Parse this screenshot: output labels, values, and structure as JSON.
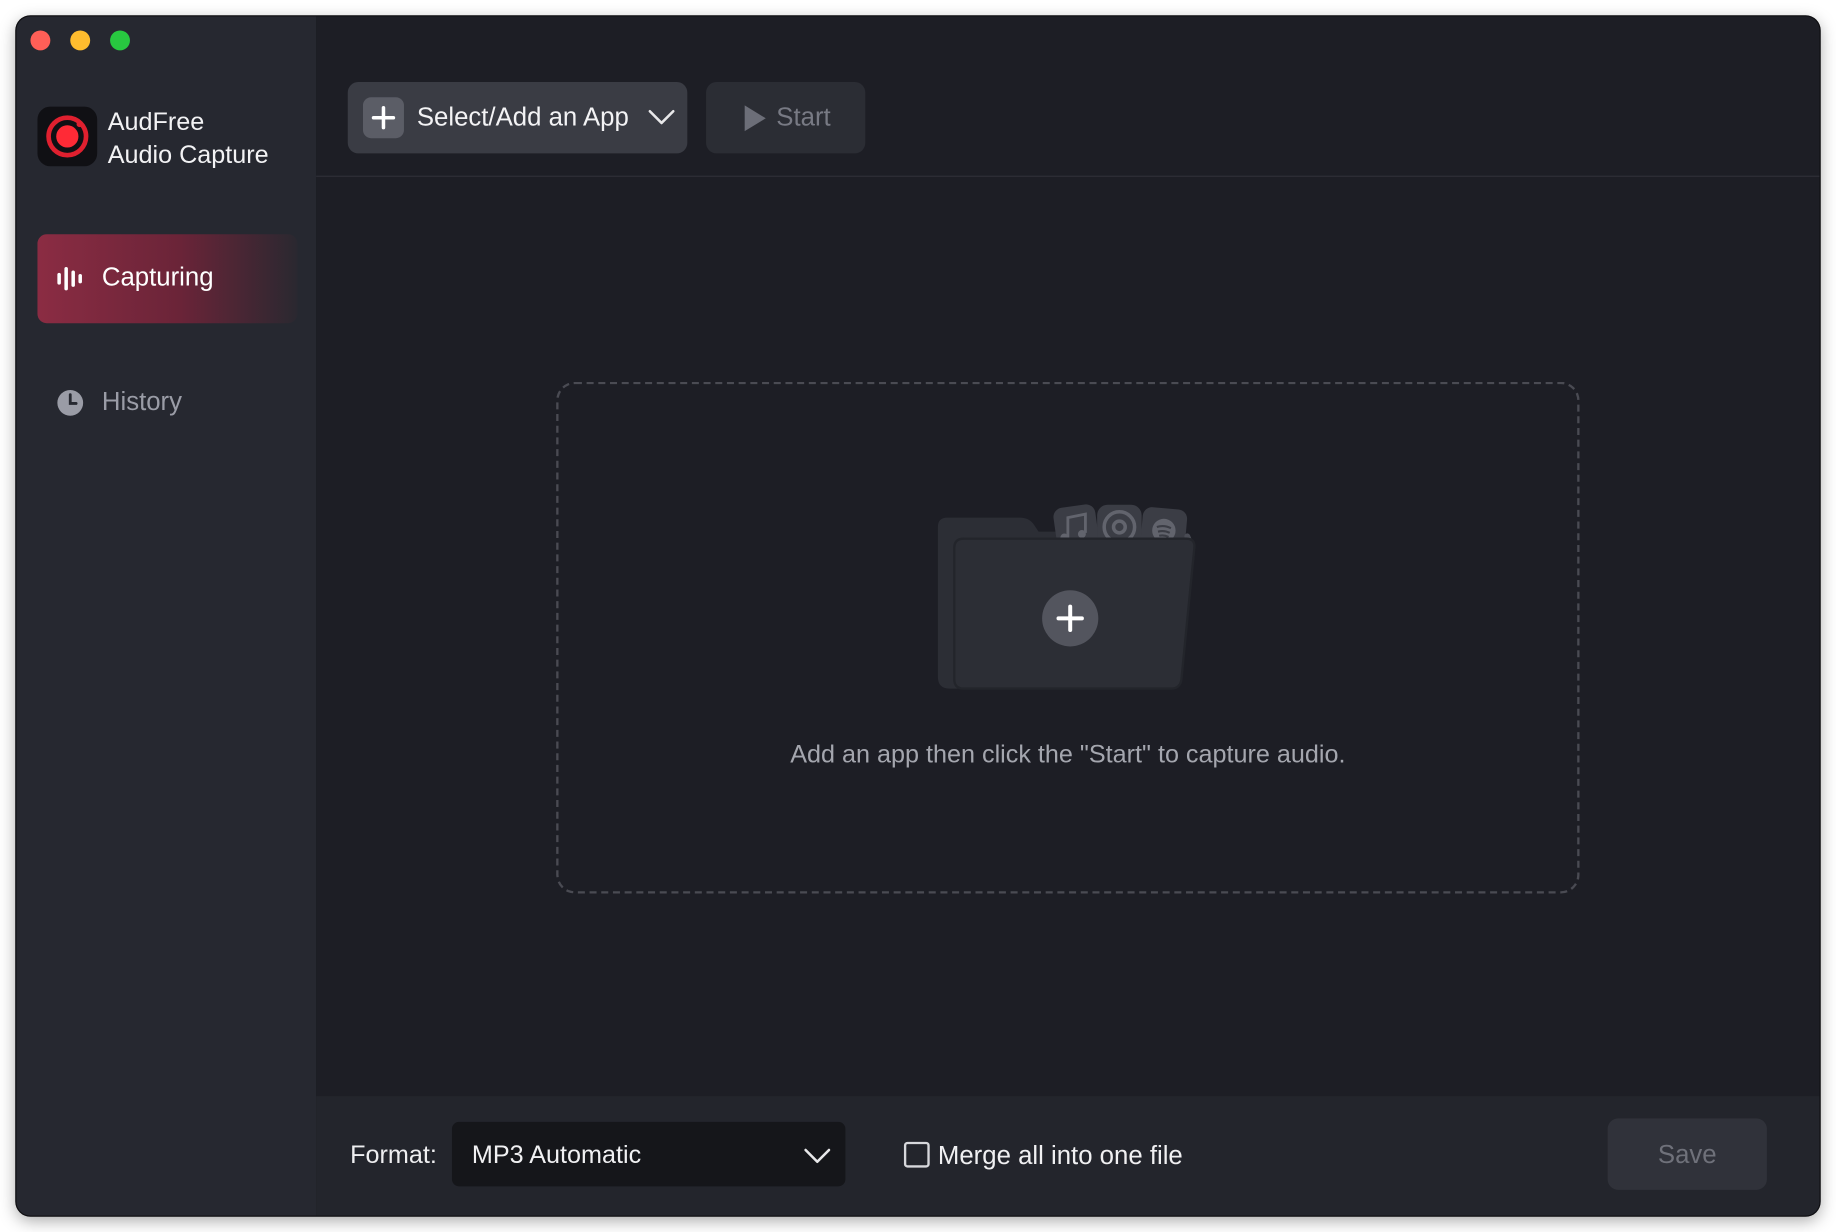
{
  "window": {
    "controls": [
      "close",
      "minimize",
      "zoom"
    ]
  },
  "brand": {
    "line1": "AudFree",
    "line2": "Audio Capture",
    "logo_icon": "record-logo-icon",
    "accent": "#e0202f"
  },
  "sidebar": {
    "items": [
      {
        "label": "Capturing",
        "icon": "waveform-icon",
        "active": true
      },
      {
        "label": "History",
        "icon": "clock-icon",
        "active": false
      }
    ]
  },
  "toolbar": {
    "select_label": "Select/Add an App",
    "start_label": "Start"
  },
  "dropzone": {
    "message": "Add an app then click the \"Start\" to capture audio.",
    "illustration_icons": [
      "music-note-icon",
      "chrome-icon",
      "spotify-icon",
      "add-icon",
      "arrow-icon"
    ]
  },
  "bottom": {
    "format_label": "Format:",
    "format_value": "MP3 Automatic",
    "merge_label": "Merge all into one file",
    "merge_checked": false,
    "save_label": "Save"
  },
  "colors": {
    "active_nav": "#8b2c43",
    "sidebar_bg": "#262830",
    "main_bg": "#1d1e25"
  }
}
